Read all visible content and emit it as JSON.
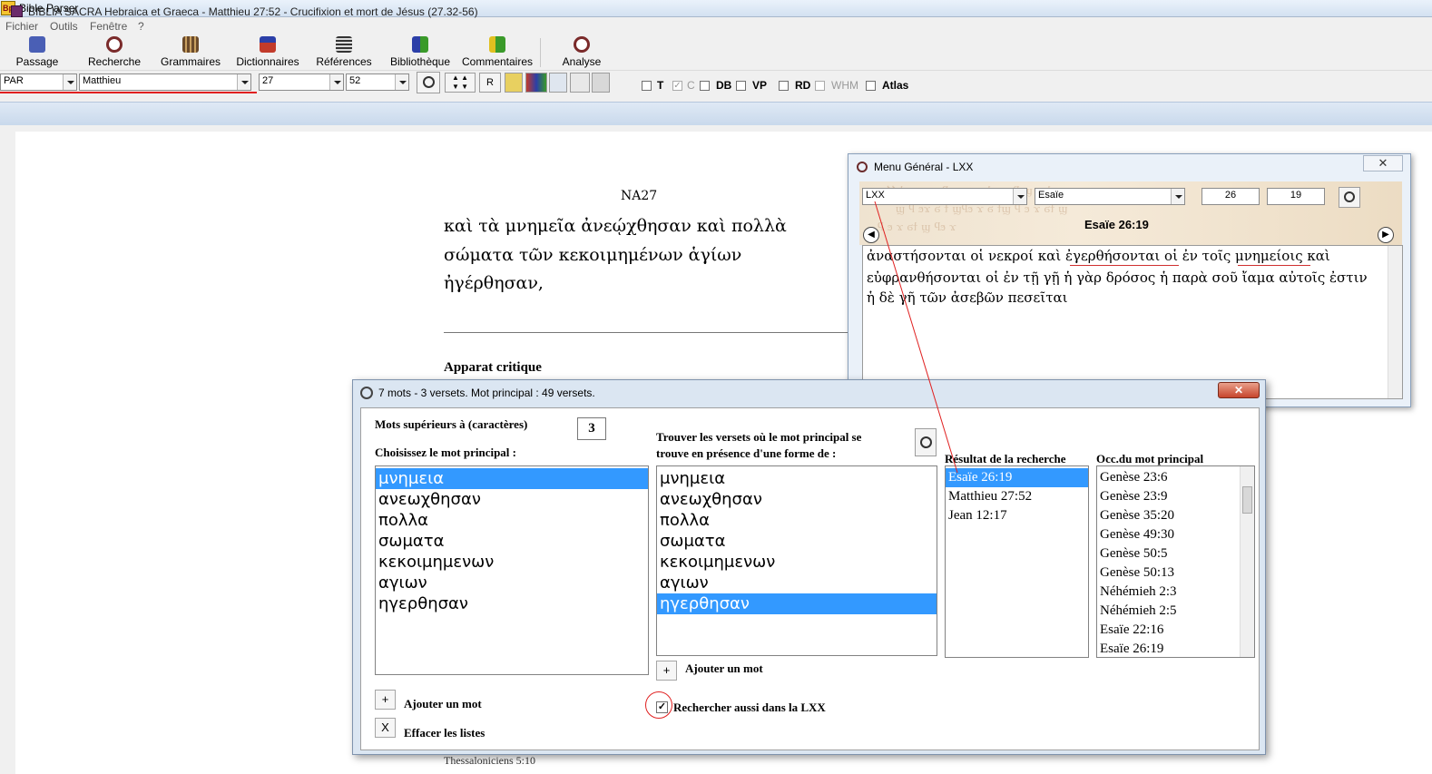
{
  "app": {
    "title": "Bible Parser",
    "icon_text": "Bp"
  },
  "menu": [
    "Fichier",
    "Outils",
    "Fenêtre",
    "?"
  ],
  "toolbar": [
    {
      "label": "Passage",
      "icon": "book-icon",
      "color": "#4a5fb5"
    },
    {
      "label": "Recherche",
      "icon": "magnifier-icon",
      "color": "#7a2a2a"
    },
    {
      "label": "Grammaires",
      "icon": "books-icon",
      "color": "#6b4a2a"
    },
    {
      "label": "Dictionnaires",
      "icon": "flag-book-icon",
      "color": "#c23b2b"
    },
    {
      "label": "Références",
      "icon": "scroll-icon",
      "color": "#333333"
    },
    {
      "label": "Bibliothèque",
      "icon": "library-icon",
      "color": "#2b3fa8"
    },
    {
      "label": "Commentaires",
      "icon": "notes-icon",
      "color": "#3a9a2a"
    },
    {
      "label": "Analyse",
      "icon": "analysis-icon",
      "color": "#7a2a2a"
    }
  ],
  "selectors": {
    "version": "PAR",
    "book": "Matthieu",
    "chapter": "27",
    "verse": "52",
    "r_button": "R"
  },
  "options": [
    {
      "label": "T",
      "checked": false,
      "dim": false
    },
    {
      "label": "C",
      "checked": true,
      "dim": true
    },
    {
      "label": "DB",
      "checked": false,
      "dim": false
    },
    {
      "label": "VP",
      "checked": false,
      "dim": false
    },
    {
      "label": "RD",
      "checked": false,
      "dim": false
    },
    {
      "label": "WHM",
      "checked": false,
      "dim": true
    },
    {
      "label": "Atlas",
      "checked": false,
      "dim": false
    }
  ],
  "document": {
    "title": "BIBLIA SACRA Hebraica et Graeca - Matthieu 27:52 - Crucifixion et mort de Jésus (27.32-56)",
    "heading": "NA27",
    "lines": [
      "καὶ τὰ μνημεῖα ἀνεῴχθησαν καὶ πολλὰ",
      "σώματα τῶν κεκοιμημένων ἁγίων",
      "ἠγέρθησαν,"
    ],
    "apparatus_title": "Apparat critique",
    "bottom_text": "Thessaloniciens 5:10"
  },
  "lxx_window": {
    "title": "Menu Général - LXX",
    "version": "LXX",
    "book": "Esaïe",
    "chapter": "26",
    "verse": "19",
    "reference": "Esaïe 26:19",
    "text_lines": [
      "ἀναστήσονται οἱ νεκροί καὶ ἐγερθήσονται οἱ ἐν τοῖς μνημείοις καὶ",
      "εὐφρανθήσονται οἱ ἐν τῇ γῇ ἡ γὰρ δρόσος ἡ παρὰ σοῦ ἴαμα αὐτοῖς ἐστιν",
      "ἡ δὲ γῆ τῶν ἀσεβῶν πεσεῖται"
    ]
  },
  "search_dialog": {
    "title": "7 mots - 3 versets. Mot principal : 49 versets.",
    "min_chars_label": "Mots supérieurs à (caractères)",
    "min_chars_value": "3",
    "choose_label": "Choisissez le mot principal :",
    "find_label_1": "Trouver les versets où le mot principal se",
    "find_label_2": "trouve en présence d'une forme de :",
    "result_label": "Résultat de la recherche",
    "occ_label": "Occ.du mot principal",
    "main_words": [
      "μνημεια",
      "ανεωχθησαν",
      "πολλα",
      "σωματα",
      "κεκοιμημενων",
      "αγιων",
      "ηγερθησαν"
    ],
    "main_selected": 0,
    "form_words": [
      "μνημεια",
      "ανεωχθησαν",
      "πολλα",
      "σωματα",
      "κεκοιμημενων",
      "αγιων",
      "ηγερθησαν"
    ],
    "form_selected": 6,
    "results": [
      "Esaïe 26:19",
      "Matthieu 27:52",
      "Jean 12:17"
    ],
    "results_selected": 0,
    "occurrences": [
      "Genèse 23:6",
      "Genèse 23:9",
      "Genèse 35:20",
      "Genèse 49:30",
      "Genèse 50:5",
      "Genèse 50:13",
      "Néhémieh 2:3",
      "Néhémieh 2:5",
      "Esaïe 22:16",
      "Esaïe 26:19"
    ],
    "add_word_left": "Ajouter un mot",
    "clear_lists": "Effacer les listes",
    "add_word_mid": "Ajouter un mot",
    "also_lxx": "Rechercher aussi dans la LXX",
    "also_lxx_checked": true,
    "plus_symbol": "+",
    "clear_symbol": "X"
  }
}
